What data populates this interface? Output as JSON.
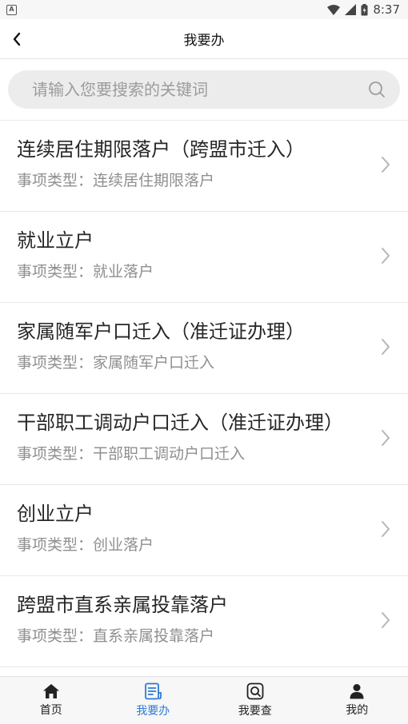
{
  "status": {
    "time": "8:37",
    "notification_icon": "A"
  },
  "nav": {
    "title": "我要办"
  },
  "search": {
    "placeholder": "请输入您要搜索的关键词",
    "value": ""
  },
  "items": [
    {
      "title": "连续居住期限落户（跨盟市迁入）",
      "subtitle": "事项类型：连续居住期限落户"
    },
    {
      "title": "就业立户",
      "subtitle": "事项类型：就业落户"
    },
    {
      "title": "家属随军户口迁入（准迁证办理）",
      "subtitle": "事项类型：家属随军户口迁入"
    },
    {
      "title": "干部职工调动户口迁入（准迁证办理）",
      "subtitle": "事项类型：干部职工调动户口迁入"
    },
    {
      "title": "创业立户",
      "subtitle": "事项类型：创业落户"
    },
    {
      "title": "跨盟市直系亲属投靠落户",
      "subtitle": "事项类型：直系亲属投靠落户"
    }
  ],
  "tabs": [
    {
      "label": "首页",
      "icon": "home-icon",
      "active": false
    },
    {
      "label": "我要办",
      "icon": "document-icon",
      "active": true
    },
    {
      "label": "我要查",
      "icon": "search-doc-icon",
      "active": false
    },
    {
      "label": "我的",
      "icon": "user-icon",
      "active": false
    }
  ],
  "colors": {
    "accent": "#2c7bd6",
    "search_bg": "#ececec",
    "subtitle": "#8f8f8f"
  }
}
